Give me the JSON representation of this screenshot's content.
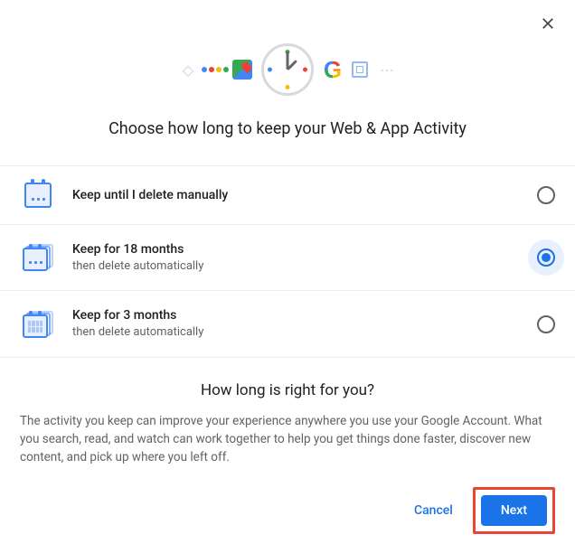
{
  "title": "Choose how long to keep your Web & App Activity",
  "options": [
    {
      "label": "Keep until I delete manually",
      "sub": "",
      "selected": false,
      "icon": "calendar-single-icon"
    },
    {
      "label": "Keep for 18 months",
      "sub": "then delete automatically",
      "selected": true,
      "icon": "calendar-stack-icon"
    },
    {
      "label": "Keep for 3 months",
      "sub": "then delete automatically",
      "selected": false,
      "icon": "calendar-grid-icon"
    }
  ],
  "info": {
    "heading": "How long is right for you?",
    "body": "The activity you keep can improve your experience anywhere you use your Google Account. What you search, read, and watch can work together to help you get things done faster, discover new content, and pick up where you left off."
  },
  "buttons": {
    "cancel": "Cancel",
    "next": "Next"
  }
}
